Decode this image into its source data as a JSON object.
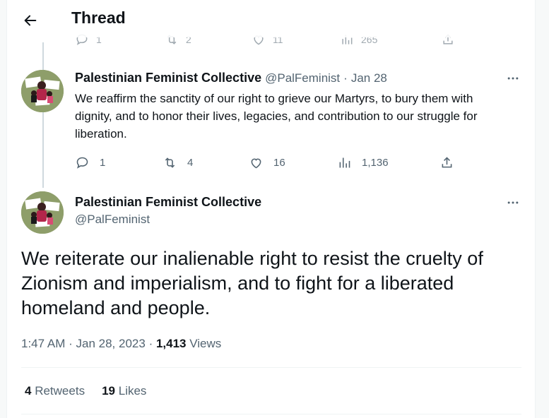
{
  "header": {
    "title": "Thread"
  },
  "previous_tweet_actions": {
    "replies": "1",
    "retweets": "2",
    "likes": "11",
    "views": "265"
  },
  "reply_tweet": {
    "display_name": "Palestinian Feminist Collective",
    "handle": "@PalFeminist",
    "separator": "·",
    "date": "Jan 28",
    "text": "We reaffirm the sanctity of our right to grieve our Martyrs, to bury them with dignity, and to honor their lives, legacies, and contribution to our struggle for liberation.",
    "replies": "1",
    "retweets": "4",
    "likes": "16",
    "views": "1,136"
  },
  "main_tweet": {
    "display_name": "Palestinian Feminist Collective",
    "handle": "@PalFeminist",
    "text": "We reiterate our inalienable right to resist the cruelty of Zionism and imperialism, and to fight for a liberated homeland and people.",
    "time": "1:47 AM",
    "separator": "·",
    "date": "Jan 28, 2023",
    "views_count": "1,413",
    "views_label": "Views",
    "retweets_count": "4",
    "retweets_label": "Retweets",
    "likes_count": "19",
    "likes_label": "Likes"
  },
  "colors": {
    "text_primary": "#0f1419",
    "text_secondary": "#536471",
    "divider": "#eff3f4",
    "thread_line": "#cfd9de",
    "avatar_bg": "#8e9e6a"
  },
  "icons": [
    "back-arrow-icon",
    "reply-icon",
    "retweet-icon",
    "like-icon",
    "views-icon",
    "share-icon",
    "more-icon"
  ]
}
